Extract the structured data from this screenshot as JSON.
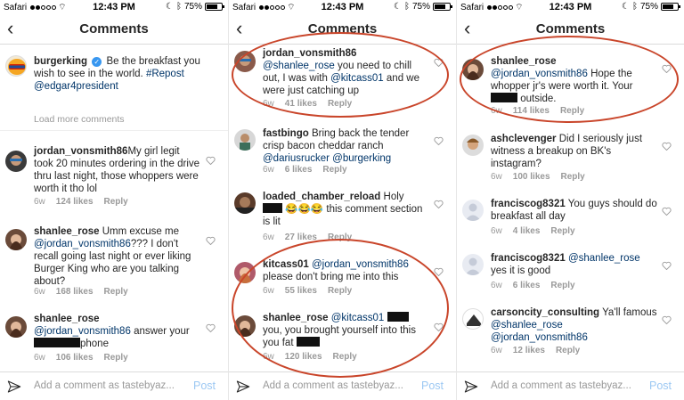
{
  "status_bar": {
    "carrier": "Safari",
    "time": "12:43 PM",
    "battery": "75%",
    "battery_level": 0.75
  },
  "colors": {
    "annotation_circle": "#c9452a",
    "mention": "#003569",
    "verified": "#3897f0",
    "post": "#9cc8f3"
  },
  "header": {
    "title": "Comments"
  },
  "input": {
    "placeholder": "Add a comment as tastebyaz...",
    "post_label": "Post"
  },
  "load_more": "Load more comments",
  "panels": [
    {
      "caption": {
        "user": "burgerking",
        "text": "Be the breakfast you wish to see in the world.",
        "hashtag": "#Repost",
        "mention": "@edgar4president"
      },
      "comments": [
        {
          "user": "jordan_vonsmith86",
          "text": "My girl legit took 20 minutes ordering in the drive thru last night, those whoppers were worth it tho lol",
          "age": "6w",
          "likes": "124 likes",
          "reply": "Reply"
        },
        {
          "user": "shanlee_rose",
          "text": "Umm excuse me",
          "mention": "@jordan_vonsmith86",
          "text2": "??? I don't recall going last night or ever liking Burger King who are you talking about?",
          "age": "6w",
          "likes": "168 likes",
          "reply": "Reply"
        },
        {
          "user": "shanlee_rose",
          "mention": "@jordan_vonsmith86",
          "text": "answer your",
          "text2": "phone",
          "age": "6w",
          "likes": "106 likes",
          "reply": "Reply"
        }
      ]
    },
    {
      "comments": [
        {
          "user": "jordan_vonsmith86",
          "mention": "@shanlee_rose",
          "text": "you need to chill out, I was with",
          "mention2": "@kitcass01",
          "text2": "and we were just catching up",
          "age": "6w",
          "likes": "41 likes",
          "reply": "Reply"
        },
        {
          "user": "fastbingo",
          "text": "Bring back the tender crisp bacon cheddar ranch",
          "mention": "@dariusrucker",
          "mention2": "@burgerking",
          "age": "6w",
          "likes": "6 likes",
          "reply": "Reply"
        },
        {
          "user": "loaded_chamber_reload",
          "text": "Holy",
          "emoji": "😂😂😂",
          "text2": "this comment section is lit",
          "age": "6w",
          "likes": "27 likes",
          "reply": "Reply"
        },
        {
          "user": "kitcass01",
          "mention": "@jordan_vonsmith86",
          "text": "please don't bring me into this",
          "age": "6w",
          "likes": "55 likes",
          "reply": "Reply"
        },
        {
          "user": "shanlee_rose",
          "mention": "@kitcass01",
          "text": "you, you brought yourself into this you fat",
          "age": "6w",
          "likes": "120 likes",
          "reply": "Reply"
        }
      ]
    },
    {
      "comments": [
        {
          "user": "shanlee_rose",
          "mention": "@jordan_vonsmith86",
          "text": "Hope the whopper jr's were worth it. Your",
          "text2": "outside.",
          "age": "6w",
          "likes": "114 likes",
          "reply": "Reply"
        },
        {
          "user": "ashclevenger",
          "text": "Did I seriously just witness a breakup on BK's instagram?",
          "age": "6w",
          "likes": "100 likes",
          "reply": "Reply"
        },
        {
          "user": "franciscog8321",
          "text": "You guys should do breakfast all day",
          "age": "6w",
          "likes": "4 likes",
          "reply": "Reply"
        },
        {
          "user": "franciscog8321",
          "mention": "@shanlee_rose",
          "text": "yes it is good",
          "age": "6w",
          "likes": "6 likes",
          "reply": "Reply"
        },
        {
          "user": "carsoncity_consulting",
          "text": "Ya'll famous",
          "mention": "@shanlee_rose",
          "mention2": "@jordan_vonsmith86",
          "age": "6w",
          "likes": "12 likes",
          "reply": "Reply"
        }
      ]
    }
  ]
}
